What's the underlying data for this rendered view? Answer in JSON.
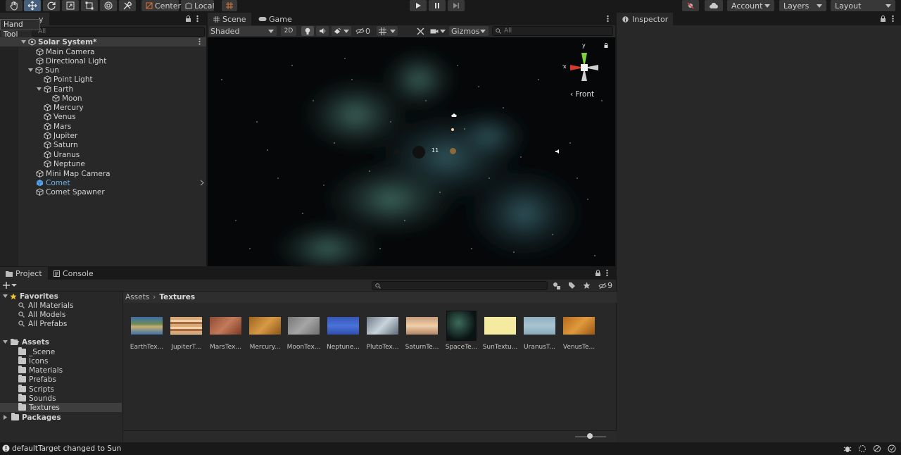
{
  "toolbar": {
    "pivot_label": "Center",
    "space_label": "Local",
    "account_label": "Account",
    "layers_label": "Layers",
    "layout_label": "Layout",
    "tooltip": "Hand Tool"
  },
  "hierarchy": {
    "tab_label": "y",
    "search_placeholder": "All",
    "scene_name": "Solar System*",
    "items": [
      {
        "label": "Main Camera"
      },
      {
        "label": "Directional Light"
      },
      {
        "label": "Sun"
      },
      {
        "label": "Point Light"
      },
      {
        "label": "Earth"
      },
      {
        "label": "Moon"
      },
      {
        "label": "Mercury"
      },
      {
        "label": "Venus"
      },
      {
        "label": "Mars"
      },
      {
        "label": "Jupiter"
      },
      {
        "label": "Saturn"
      },
      {
        "label": "Uranus"
      },
      {
        "label": "Neptune"
      },
      {
        "label": "Mini Map Camera"
      },
      {
        "label": "Comet"
      },
      {
        "label": "Comet Spawner"
      }
    ]
  },
  "scene": {
    "tabs": [
      "Scene",
      "Game"
    ],
    "shading_mode": "Shaded",
    "twod_label": "2D",
    "hidden_count": "0",
    "gizmos_label": "Gizmos",
    "search_placeholder": "All",
    "view_label": "Front",
    "axis_x": "x",
    "axis_y": "y",
    "label_fragment": "11"
  },
  "inspector": {
    "tab_label": "Inspector"
  },
  "project": {
    "tabs": [
      "Project",
      "Console"
    ],
    "hidden_count": "9",
    "breadcrumb": [
      "Assets",
      "Textures"
    ],
    "favorites_label": "Favorites",
    "favorites": [
      "All Materials",
      "All Models",
      "All Prefabs"
    ],
    "assets_label": "Assets",
    "asset_folders": [
      "_Scene",
      "Icons",
      "Materials",
      "Prefabs",
      "Scripts",
      "Sounds",
      "Textures"
    ],
    "packages_label": "Packages",
    "files": [
      {
        "name": "EarthTex...",
        "color": "#3b6ea5"
      },
      {
        "name": "JupiterT...",
        "color": "#c98f5c"
      },
      {
        "name": "MarsTex...",
        "color": "#a2573a"
      },
      {
        "name": "Mercury...",
        "color": "#b9772e"
      },
      {
        "name": "MoonTex...",
        "color": "#8d8d8d"
      },
      {
        "name": "Neptune...",
        "color": "#3f63c8"
      },
      {
        "name": "PlutoTex...",
        "color": "#9aa7b2"
      },
      {
        "name": "SaturnTe...",
        "color": "#dcb48a"
      },
      {
        "name": "SpaceTe...",
        "color": "#0c1a1a"
      },
      {
        "name": "SunTextu...",
        "color": "#f4eba1"
      },
      {
        "name": "UranusT...",
        "color": "#9bb8c6"
      },
      {
        "name": "VenusTe...",
        "color": "#c77a26"
      }
    ]
  },
  "status": {
    "message": "defaultTarget changed to Sun"
  }
}
